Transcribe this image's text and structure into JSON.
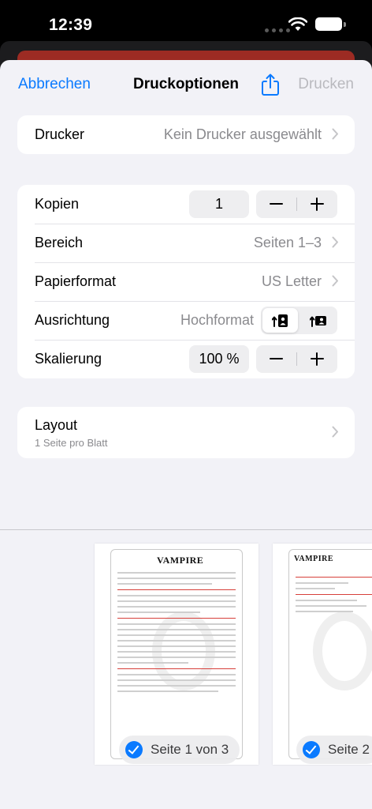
{
  "status": {
    "time": "12:39"
  },
  "nav": {
    "cancel": "Abbrechen",
    "title": "Druckoptionen",
    "print": "Drucken",
    "share_icon": "share-icon"
  },
  "printer": {
    "label": "Drucker",
    "value": "Kein Drucker ausgewählt"
  },
  "options": {
    "copies": {
      "label": "Kopien",
      "value": "1"
    },
    "range": {
      "label": "Bereich",
      "value": "Seiten 1–3"
    },
    "paper": {
      "label": "Papierformat",
      "value": "US Letter"
    },
    "orientation": {
      "label": "Ausrichtung",
      "value": "Hochformat",
      "selected": "portrait"
    },
    "scaling": {
      "label": "Skalierung",
      "value": "100 %"
    }
  },
  "layout": {
    "label": "Layout",
    "sub": "1 Seite pro Blatt"
  },
  "previews": [
    {
      "logo": "VAMPIRE",
      "badge": "Seite 1 von 3",
      "selected": true
    },
    {
      "logo": "VAMPIRE",
      "badge": "Seite 2",
      "selected": true
    }
  ],
  "colors": {
    "accent": "#0a7aff",
    "disabled": "#b9b9be",
    "background": "#f2f2f7",
    "behind_banner": "#9c2b23"
  }
}
